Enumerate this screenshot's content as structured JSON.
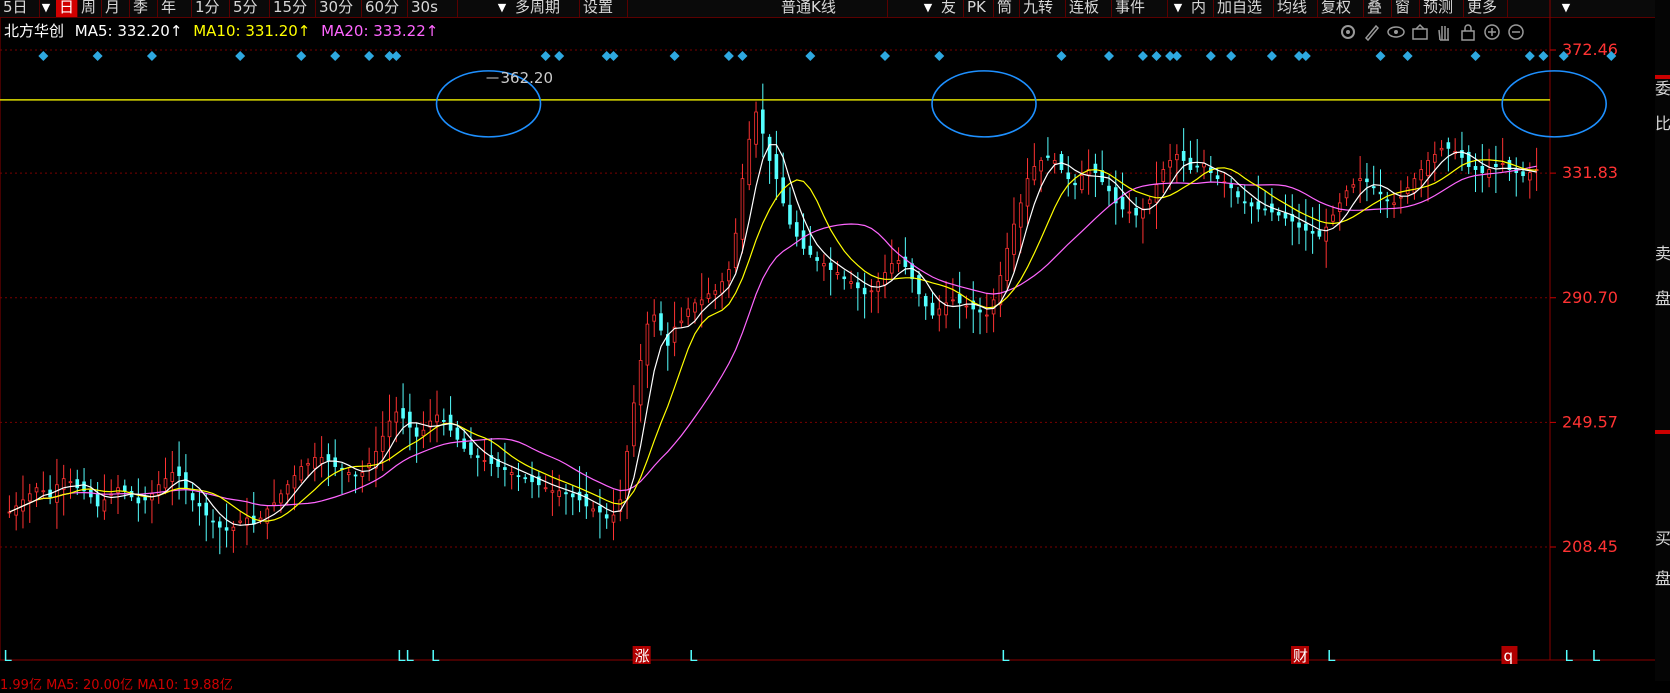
{
  "toolbar": {
    "items": [
      {
        "label": "5日",
        "x": 0,
        "w": 40
      },
      {
        "label": "日",
        "x": 56,
        "w": 22,
        "active": true
      },
      {
        "label": "周",
        "x": 78,
        "w": 24
      },
      {
        "label": "月",
        "x": 102,
        "w": 28
      },
      {
        "label": "季",
        "x": 130,
        "w": 28
      },
      {
        "label": "年",
        "x": 158,
        "w": 34
      },
      {
        "label": "1分",
        "x": 192,
        "w": 38
      },
      {
        "label": "5分",
        "x": 230,
        "w": 40
      },
      {
        "label": "15分",
        "x": 270,
        "w": 46
      },
      {
        "label": "30分",
        "x": 316,
        "w": 46
      },
      {
        "label": "60分",
        "x": 362,
        "w": 46
      },
      {
        "label": "30s",
        "x": 408,
        "w": 50
      },
      {
        "label": "多周期",
        "x": 512,
        "w": 68
      },
      {
        "label": "设置",
        "x": 580,
        "w": 48
      },
      {
        "label": "普通K线",
        "x": 778,
        "w": 110
      },
      {
        "label": "友",
        "x": 938,
        "w": 26
      },
      {
        "label": "PK",
        "x": 964,
        "w": 30
      },
      {
        "label": "筒",
        "x": 994,
        "w": 26
      },
      {
        "label": "九转",
        "x": 1020,
        "w": 46
      },
      {
        "label": "连板",
        "x": 1066,
        "w": 46
      },
      {
        "label": "事件",
        "x": 1112,
        "w": 56
      },
      {
        "label": "内",
        "x": 1188,
        "w": 26
      },
      {
        "label": "加自选",
        "x": 1214,
        "w": 60
      },
      {
        "label": "均线",
        "x": 1274,
        "w": 44
      },
      {
        "label": "复权",
        "x": 1318,
        "w": 46
      },
      {
        "label": "叠",
        "x": 1364,
        "w": 28
      },
      {
        "label": "窗",
        "x": 1392,
        "w": 28
      },
      {
        "label": "预测",
        "x": 1420,
        "w": 44
      },
      {
        "label": "更多",
        "x": 1464,
        "w": 44
      }
    ],
    "arrows": [
      {
        "x": 38
      },
      {
        "x": 494
      },
      {
        "x": 920
      },
      {
        "x": 1170
      },
      {
        "x": 1558
      }
    ]
  },
  "legend": {
    "name": "北方华创",
    "ma5": "MA5: 332.20↑",
    "ma10": "MA10: 331.20↑",
    "ma20": "MA20: 333.22↑"
  },
  "tools": [
    "gear-icon",
    "pen-icon",
    "eye-icon",
    "basket-icon",
    "hand-icon",
    "lock-icon",
    "plus-circle-icon",
    "minus-circle-icon"
  ],
  "right_panel": [
    "委",
    "比",
    "卖",
    "盘",
    "买",
    "盘"
  ],
  "bottom_line": "1.99亿   MA5: 20.00亿   MA10: 19.88亿",
  "colors": {
    "up": "#ff3232",
    "down": "#54ffff",
    "ma5": "#ffffff",
    "ma10": "#ffff00",
    "ma20": "#ff66ff",
    "resistance": "#dddd00",
    "ellipse": "#1e90ff",
    "marker": "#2ea8e0",
    "axis_text": "#ff3333"
  },
  "chart_data": {
    "type": "candlestick",
    "y_ticks": [
      372.46,
      331.83,
      290.7,
      249.57,
      208.45
    ],
    "ylim": [
      208.45,
      372.46
    ],
    "max_label": "362.20",
    "resistance_level": 356,
    "highlighted_peaks": [
      70,
      143,
      227
    ],
    "bottom_markers": [
      {
        "label": "L",
        "bar": 0
      },
      {
        "label": "LL",
        "bar": 58
      },
      {
        "label": "L",
        "bar": 63
      },
      {
        "label": "涨",
        "bar": 93
      },
      {
        "label": "L",
        "bar": 101
      },
      {
        "label": "L",
        "bar": 147
      },
      {
        "label": "财",
        "bar": 190
      },
      {
        "label": "L",
        "bar": 195
      },
      {
        "label": "q",
        "bar": 221
      },
      {
        "label": "L",
        "bar": 230
      },
      {
        "label": "L",
        "bar": 234
      }
    ],
    "top_diamond_bars": [
      5,
      13,
      21,
      34,
      43,
      48,
      53,
      56,
      57,
      79,
      81,
      88,
      89,
      98,
      106,
      108,
      118,
      129,
      137,
      155,
      162,
      167,
      169,
      171,
      172,
      177,
      180,
      186,
      190,
      191,
      202,
      206,
      216,
      224,
      226,
      229,
      236
    ],
    "closes": [
      220,
      222,
      224,
      226,
      228,
      227,
      225,
      229,
      231,
      230,
      228,
      227,
      225,
      222,
      224,
      226,
      228,
      227,
      225,
      223,
      224,
      226,
      229,
      231,
      233,
      232,
      228,
      224,
      222,
      219,
      217,
      215,
      214,
      215,
      217,
      218,
      216,
      218,
      221,
      223,
      226,
      229,
      232,
      235,
      236,
      238,
      238,
      237,
      235,
      234,
      233,
      232,
      233,
      236,
      240,
      245,
      250,
      253,
      251,
      248,
      245,
      247,
      250,
      252,
      250,
      247,
      244,
      241,
      239,
      238,
      237,
      236,
      235,
      234,
      233,
      232,
      231,
      230,
      229,
      228,
      227,
      227,
      226,
      225,
      224,
      222,
      221,
      220,
      218,
      219,
      224,
      240,
      256,
      270,
      282,
      285,
      280,
      275,
      281,
      283,
      287,
      289,
      290,
      292,
      293,
      296,
      300,
      312,
      330,
      343,
      352,
      345,
      336,
      330,
      322,
      315,
      311,
      307,
      305,
      303,
      302,
      300,
      299,
      297,
      296,
      294,
      292,
      293,
      296,
      299,
      302,
      303,
      301,
      297,
      292,
      288,
      285,
      287,
      289,
      290,
      289,
      288,
      287,
      286,
      285,
      290,
      298,
      307,
      315,
      322,
      330,
      334,
      336,
      337,
      336,
      333,
      330,
      328,
      331,
      333,
      332,
      329,
      326,
      322,
      320,
      319,
      318,
      320,
      323,
      328,
      333,
      336,
      338,
      336,
      333,
      334,
      335,
      332,
      330,
      329,
      327,
      324,
      322,
      321,
      320,
      320,
      319,
      318,
      317,
      316,
      314,
      313,
      312,
      311,
      314,
      318,
      322,
      326,
      328,
      330,
      329,
      327,
      325,
      323,
      322,
      324,
      327,
      330,
      333,
      336,
      338,
      340,
      340,
      339,
      337,
      334,
      333,
      332,
      333,
      334,
      335,
      333,
      332,
      331,
      332,
      333
    ]
  }
}
